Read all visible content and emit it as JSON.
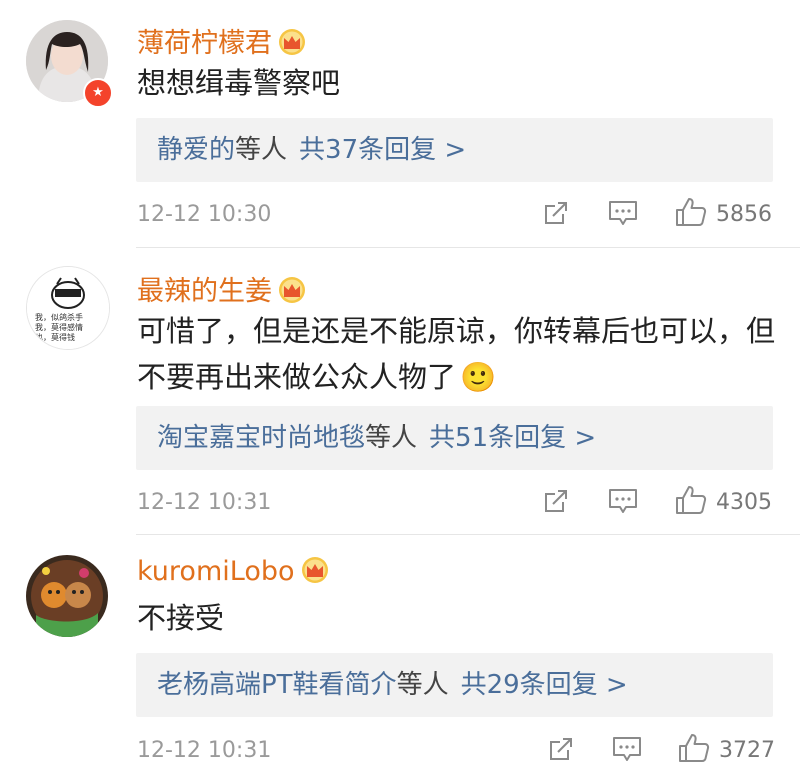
{
  "comments": [
    {
      "username": "薄荷柠檬君",
      "text": "想想缉毒警察吧",
      "reply_names": "静爱的",
      "reply_deng": "等人",
      "reply_count": "共37条回复 >",
      "time": "12-12 10:30",
      "likes": "5856"
    },
    {
      "username": "最辣的生姜",
      "text": "可惜了，但是还是不能原谅，你转幕后也可以，但不要再出来做公众人物了",
      "emoji": "🙂",
      "avatar_text": [
        "我，似鸽杀手",
        "我，莫得感情",
        "也，莫得钱"
      ],
      "reply_names": "淘宝嘉宝时尚地毯",
      "reply_deng": "等人",
      "reply_count": "共51条回复 >",
      "time": "12-12 10:31",
      "likes": "4305"
    },
    {
      "username": "kuromiLobo",
      "text": "不接受",
      "reply_names": "老杨高端PT鞋看简介",
      "reply_deng": "等人",
      "reply_count": "共29条回复 >",
      "time": "12-12 10:31",
      "likes": "3727"
    }
  ],
  "icons": {
    "crown": "crown-icon",
    "repost": "repost-icon",
    "comment": "comment-icon",
    "like": "like-icon"
  },
  "colors": {
    "username": "#e0701d",
    "reply_link": "#4a6e9a",
    "meta": "#9a9a9a"
  }
}
